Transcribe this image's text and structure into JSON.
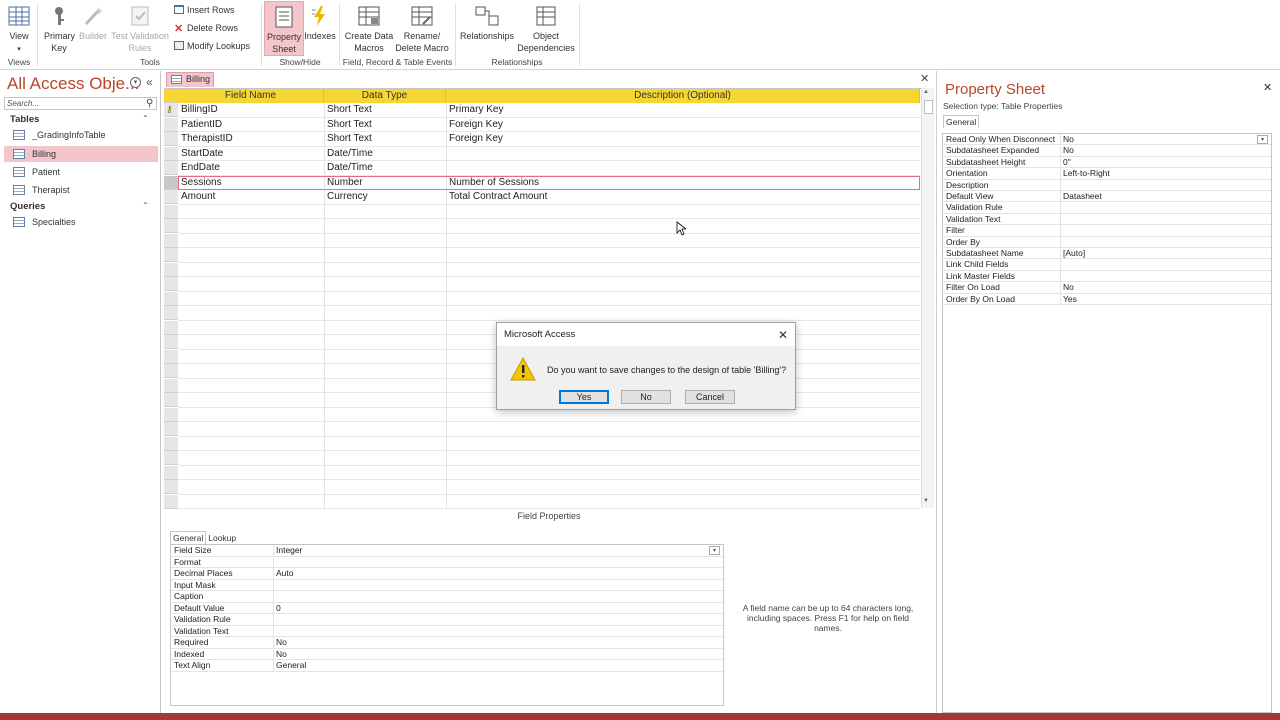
{
  "ribbon": {
    "view": "View",
    "primary_key": "Primary Key",
    "builder": "Builder",
    "test_validation": "Test Validation Rules",
    "insert_rows": "Insert Rows",
    "delete_rows": "Delete Rows",
    "modify_lookups": "Modify Lookups",
    "property_sheet": "Property Sheet",
    "indexes": "Indexes",
    "create_data_macros": "Create Data Macros",
    "rename_delete_macro": "Rename/ Delete Macro",
    "relationships": "Relationships",
    "object_dependencies": "Object Dependencies",
    "groups": {
      "views": "Views",
      "tools": "Tools",
      "show_hide": "Show/Hide",
      "field_events": "Field, Record & Table Events",
      "relationships": "Relationships"
    }
  },
  "nav": {
    "title": "All Access Obje...",
    "search_placeholder": "Search...",
    "tables_header": "Tables",
    "tables": [
      "_GradingInfoTable",
      "Billing",
      "Patient",
      "Therapist"
    ],
    "selected_table": "Billing",
    "queries_header": "Queries",
    "queries": [
      "Specialties"
    ]
  },
  "document": {
    "tab": "Billing",
    "columns": [
      "Field Name",
      "Data Type",
      "Description (Optional)"
    ],
    "rows": [
      {
        "field": "BillingID",
        "type": "Short Text",
        "desc": "Primary Key",
        "key": true
      },
      {
        "field": "PatientID",
        "type": "Short Text",
        "desc": "Foreign Key"
      },
      {
        "field": "TherapistID",
        "type": "Short Text",
        "desc": "Foreign Key"
      },
      {
        "field": "StartDate",
        "type": "Date/Time",
        "desc": ""
      },
      {
        "field": "EndDate",
        "type": "Date/Time",
        "desc": ""
      },
      {
        "field": "Sessions",
        "type": "Number",
        "desc": "Number of Sessions",
        "selected": true
      },
      {
        "field": "Amount",
        "type": "Currency",
        "desc": "Total Contract Amount"
      }
    ]
  },
  "field_properties": {
    "label": "Field Properties",
    "tabs": [
      "General",
      "Lookup"
    ],
    "rows": [
      {
        "k": "Field Size",
        "v": "Integer"
      },
      {
        "k": "Format",
        "v": ""
      },
      {
        "k": "Decimal Places",
        "v": "Auto"
      },
      {
        "k": "Input Mask",
        "v": ""
      },
      {
        "k": "Caption",
        "v": ""
      },
      {
        "k": "Default Value",
        "v": "0"
      },
      {
        "k": "Validation Rule",
        "v": ""
      },
      {
        "k": "Validation Text",
        "v": ""
      },
      {
        "k": "Required",
        "v": "No"
      },
      {
        "k": "Indexed",
        "v": "No"
      },
      {
        "k": "Text Align",
        "v": "General"
      }
    ],
    "hint": "A field name can be up to 64 characters long, including spaces. Press F1 for help on field names."
  },
  "property_sheet": {
    "title": "Property Sheet",
    "selection_type": "Selection type:  Table Properties",
    "tab": "General",
    "rows": [
      {
        "k": "Read Only When Disconnect",
        "v": "No"
      },
      {
        "k": "Subdatasheet Expanded",
        "v": "No"
      },
      {
        "k": "Subdatasheet Height",
        "v": "0\""
      },
      {
        "k": "Orientation",
        "v": "Left-to-Right"
      },
      {
        "k": "Description",
        "v": ""
      },
      {
        "k": "Default View",
        "v": "Datasheet"
      },
      {
        "k": "Validation Rule",
        "v": ""
      },
      {
        "k": "Validation Text",
        "v": ""
      },
      {
        "k": "Filter",
        "v": ""
      },
      {
        "k": "Order By",
        "v": ""
      },
      {
        "k": "Subdatasheet Name",
        "v": "[Auto]"
      },
      {
        "k": "Link Child Fields",
        "v": ""
      },
      {
        "k": "Link Master Fields",
        "v": ""
      },
      {
        "k": "Filter On Load",
        "v": "No"
      },
      {
        "k": "Order By On Load",
        "v": "Yes"
      }
    ]
  },
  "dialog": {
    "title": "Microsoft Access",
    "message": "Do you want to save changes to the design of table 'Billing'?",
    "yes": "Yes",
    "no": "No",
    "cancel": "Cancel"
  },
  "colors": {
    "accent": "#a4373a",
    "header_yellow": "#f5d633",
    "selection_pink": "#f4c6cc"
  }
}
